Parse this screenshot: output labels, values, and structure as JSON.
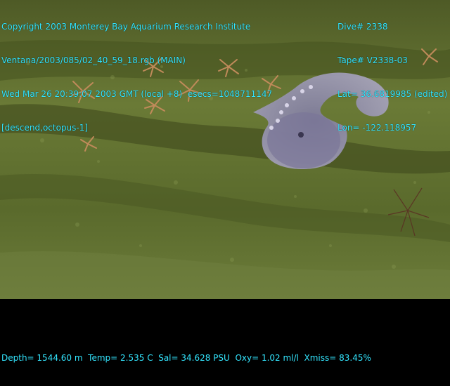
{
  "overlay": {
    "left_lines": [
      "Copyright 2003 Monterey Bay Aquarium Research Institute",
      "Ventana/2003/085/02_40_59_18.rgb (MAIN)",
      "Wed Mar 26 20:39:07 2003 GMT (local +8)  esecs=1048711147",
      "[descend,octopus-1]"
    ],
    "right_lines": [
      "Dive# 2338",
      "Tape# V2338-03",
      "Lat= 36.6819985 (edited)",
      "Lon= -122.118957"
    ],
    "bottom_line": "Depth= 1544.60 m  Temp= 2.535 C  Sal= 34.628 PSU  Oxy= 1.02 ml/l  Xmiss= 83.45%"
  },
  "colors": {
    "overlay_text": "#33e6ff",
    "seafloor": "#5a6a2c",
    "octopus": "#8d88a8"
  }
}
